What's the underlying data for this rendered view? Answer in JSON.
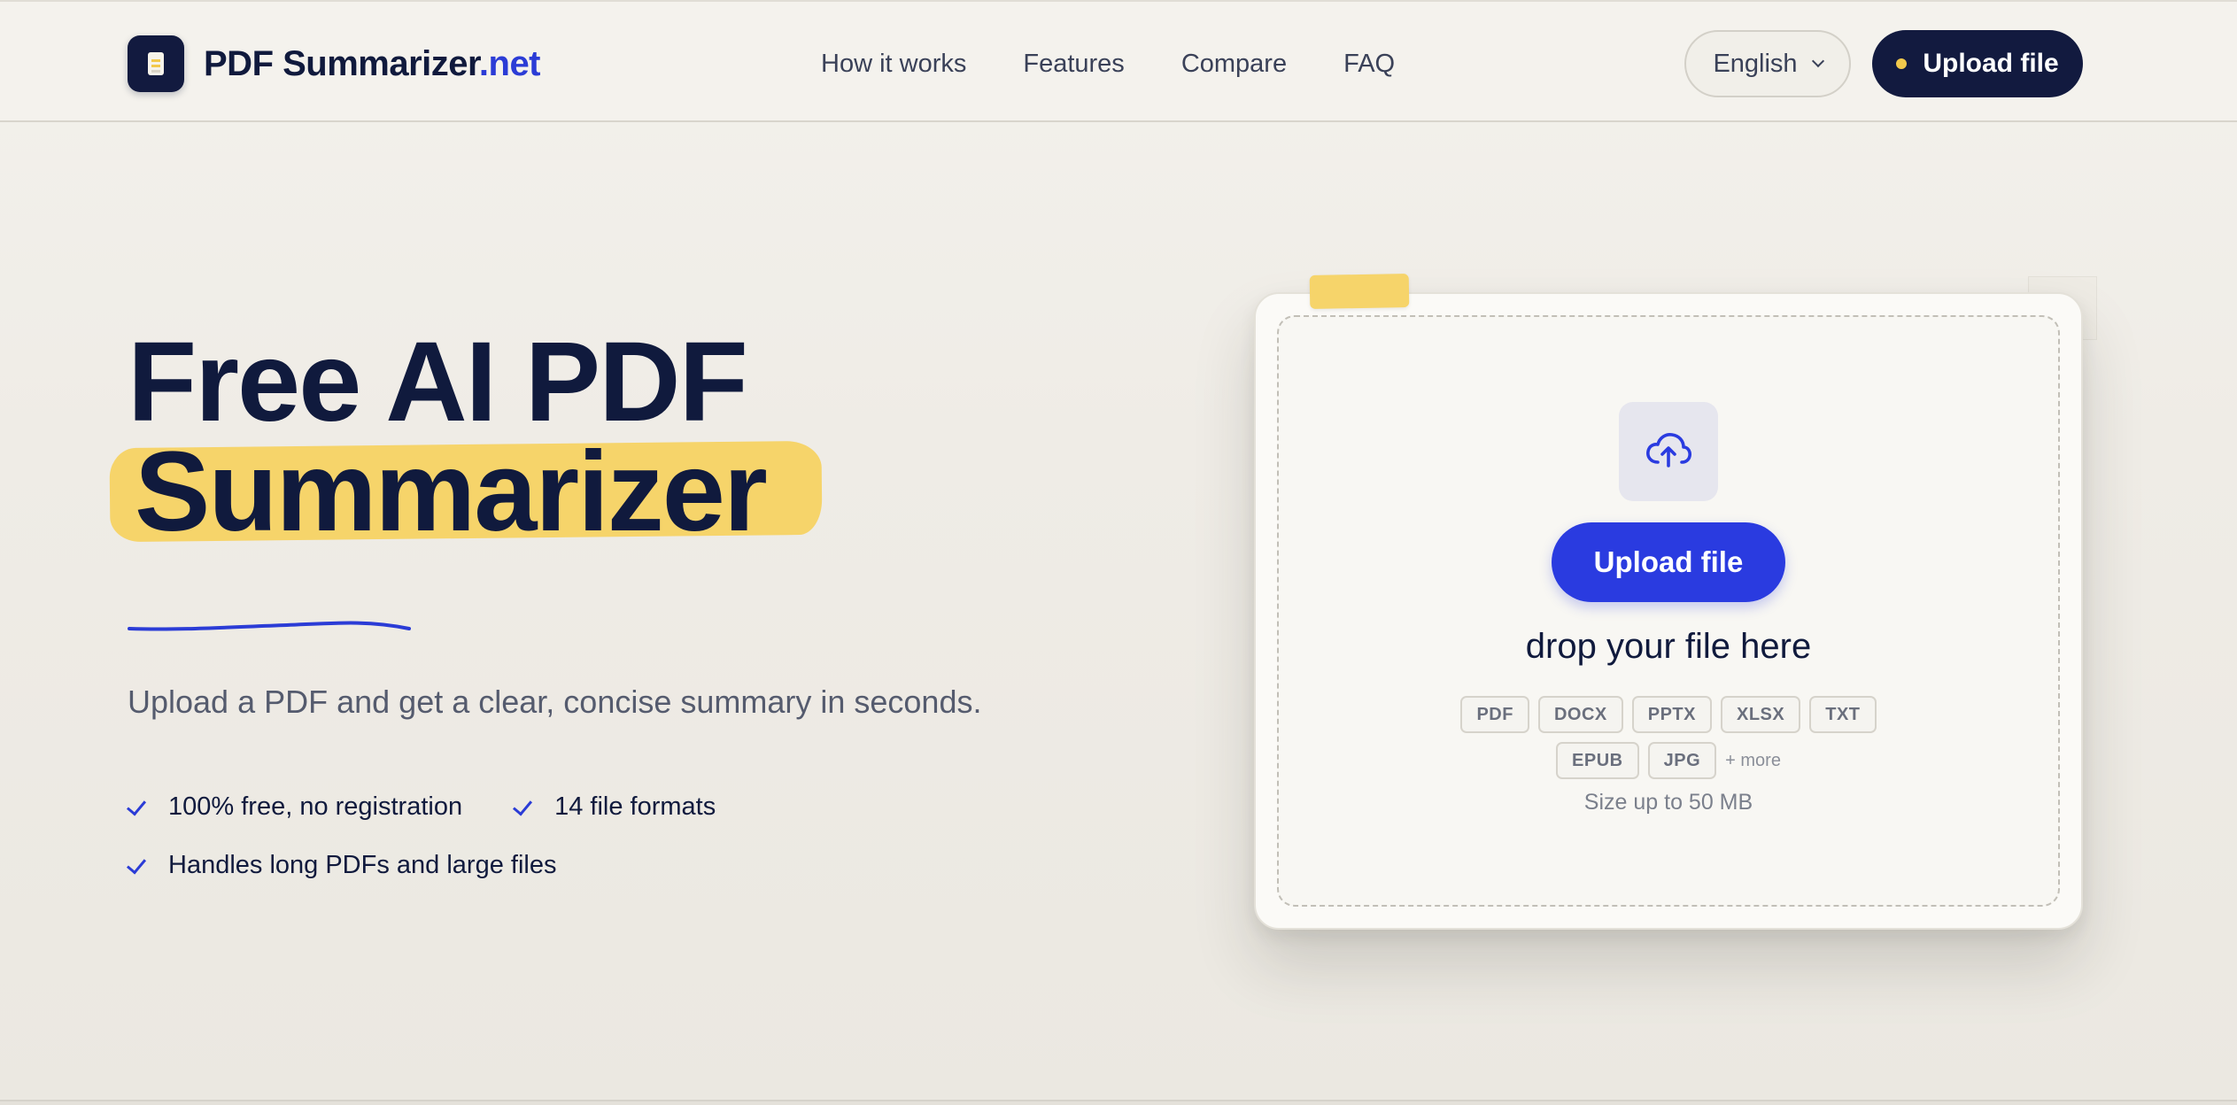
{
  "header": {
    "logo": {
      "name": "PDF Summarizer",
      "tld": ".net",
      "icon": "document-icon"
    },
    "nav": [
      {
        "label": "How it works"
      },
      {
        "label": "Features"
      },
      {
        "label": "Compare"
      },
      {
        "label": "FAQ"
      }
    ],
    "language": {
      "value": "English",
      "icon": "chevron-down-icon"
    },
    "upload_button": {
      "label": "Upload file"
    }
  },
  "hero": {
    "title_line1": "Free AI PDF",
    "title_line2": "Summarizer",
    "subtitle": "Upload a PDF and get a clear, concise summary in seconds.",
    "perks": [
      {
        "label": "100% free, no registration",
        "icon": "check-icon"
      },
      {
        "label": "14 file formats",
        "icon": "check-icon"
      },
      {
        "label": "Handles long PDFs and large files",
        "icon": "check-icon"
      }
    ]
  },
  "upload_card": {
    "icon": "cloud-upload-icon",
    "button_label": "Upload file",
    "drop_text": "drop your file here",
    "formats": [
      "PDF",
      "DOCX",
      "PPTX",
      "XLSX",
      "TXT",
      "EPUB",
      "JPG"
    ],
    "more_label": "+ more",
    "size_text": "Size up to 50 MB"
  },
  "colors": {
    "navy": "#121a3f",
    "accent_blue": "#2a3be0",
    "highlight_yellow": "#f6d46a",
    "background": "#efece5"
  }
}
